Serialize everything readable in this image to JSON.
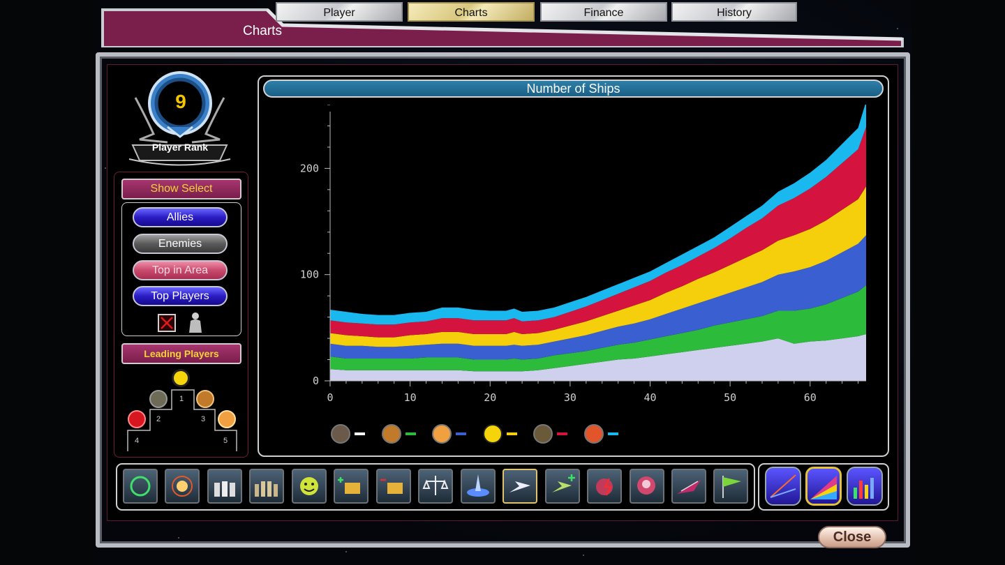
{
  "window": {
    "title": "Charts"
  },
  "tabs": [
    {
      "label": "Player",
      "active": false
    },
    {
      "label": "Charts",
      "active": true
    },
    {
      "label": "Finance",
      "active": false
    },
    {
      "label": "History",
      "active": false
    }
  ],
  "rank": {
    "value": "9",
    "label": "Player Rank"
  },
  "show_select": {
    "header": "Show Select",
    "buttons": [
      "Allies",
      "Enemies",
      "Top in Area",
      "Top Players"
    ]
  },
  "leading_players": {
    "header": "Leading Players",
    "places": [
      "1",
      "2",
      "3",
      "4",
      "5"
    ]
  },
  "close_label": "Close",
  "colors": {
    "accent_maroon": "#7a1e4b",
    "title_bar": "#1a5f86",
    "series_lavender": "#cfd0ee",
    "series_green": "#2dbb3c",
    "series_blue": "#3a5fd0",
    "series_yellow": "#f5cf0b",
    "series_red": "#d4143f",
    "series_cyan": "#19b9f0"
  },
  "toolbar_icons": [
    "green-orb-icon",
    "explosion-icon",
    "crowd-icon",
    "army-icon",
    "smiley-icon",
    "money-plus-icon",
    "money-minus-icon",
    "scales-icon",
    "planet-beam-icon",
    "ship-icon",
    "ship-plus-icon",
    "red-explosion-icon",
    "alien-attack-icon",
    "fighter-icon",
    "flag-icon"
  ],
  "view_buttons": [
    "line-chart-icon",
    "area-chart-icon",
    "bar-chart-icon"
  ],
  "chart_data": {
    "type": "area",
    "stacked": true,
    "title": "Number of Ships",
    "xlabel": "",
    "ylabel": "",
    "xlim": [
      0,
      67
    ],
    "ylim": [
      0,
      260
    ],
    "xticks": [
      0,
      10,
      20,
      30,
      40,
      50,
      60
    ],
    "yticks": [
      0,
      100,
      200
    ],
    "grid": false,
    "legend_position": "bottom",
    "x": [
      0,
      2,
      4,
      6,
      8,
      10,
      12,
      14,
      16,
      18,
      20,
      22,
      23,
      24,
      26,
      28,
      30,
      32,
      34,
      36,
      38,
      40,
      42,
      44,
      46,
      48,
      50,
      52,
      54,
      56,
      58,
      60,
      62,
      64,
      66,
      67
    ],
    "series": [
      {
        "values": [
          11,
          10,
          10,
          10,
          10,
          10,
          10,
          10,
          10,
          9,
          9,
          9,
          9,
          9,
          10,
          12,
          14,
          16,
          18,
          20,
          21,
          23,
          25,
          27,
          29,
          31,
          33,
          35,
          37,
          40,
          35,
          37,
          38,
          40,
          42,
          44
        ],
        "color": "#cfd0ee"
      },
      {
        "values": [
          12,
          11,
          11,
          11,
          11,
          11,
          12,
          12,
          12,
          11,
          11,
          11,
          12,
          11,
          11,
          12,
          12,
          12,
          13,
          14,
          15,
          16,
          17,
          18,
          19,
          21,
          22,
          23,
          24,
          26,
          31,
          31,
          34,
          38,
          42,
          46
        ],
        "color": "#2dbb3c"
      },
      {
        "values": [
          12,
          12,
          12,
          11,
          11,
          12,
          12,
          13,
          13,
          13,
          13,
          13,
          13,
          13,
          13,
          13,
          14,
          15,
          16,
          17,
          18,
          19,
          21,
          23,
          25,
          26,
          28,
          30,
          32,
          34,
          37,
          39,
          41,
          43,
          45,
          47
        ],
        "color": "#3a5fd0"
      },
      {
        "values": [
          10,
          10,
          9,
          9,
          9,
          10,
          10,
          11,
          11,
          11,
          11,
          11,
          12,
          11,
          11,
          11,
          12,
          13,
          14,
          15,
          17,
          18,
          20,
          21,
          23,
          24,
          26,
          28,
          30,
          32,
          34,
          36,
          38,
          40,
          42,
          46
        ],
        "color": "#f5cf0b"
      },
      {
        "values": [
          12,
          12,
          12,
          12,
          12,
          12,
          12,
          13,
          13,
          13,
          13,
          13,
          13,
          12,
          12,
          12,
          13,
          14,
          15,
          16,
          17,
          18,
          19,
          20,
          21,
          23,
          25,
          28,
          30,
          33,
          35,
          38,
          41,
          44,
          47,
          56
        ],
        "color": "#d4143f"
      },
      {
        "values": [
          10,
          10,
          9,
          9,
          9,
          9,
          9,
          10,
          10,
          10,
          9,
          9,
          9,
          9,
          9,
          9,
          9,
          9,
          9,
          9,
          9,
          9,
          9,
          10,
          10,
          10,
          11,
          11,
          12,
          13,
          14,
          15,
          16,
          18,
          20,
          24
        ],
        "color": "#19b9f0"
      }
    ],
    "legend": [
      {
        "icon": "race-grey-icon",
        "color": "#ffffff"
      },
      {
        "icon": "race-brown-icon",
        "color": "#2dbb3c"
      },
      {
        "icon": "race-orange-icon",
        "color": "#3a5fd0"
      },
      {
        "icon": "race-yellow-icon",
        "color": "#f5cf0b"
      },
      {
        "icon": "race-leaf-icon",
        "color": "#d4143f"
      },
      {
        "icon": "race-red-icon",
        "color": "#19b9f0"
      }
    ]
  }
}
